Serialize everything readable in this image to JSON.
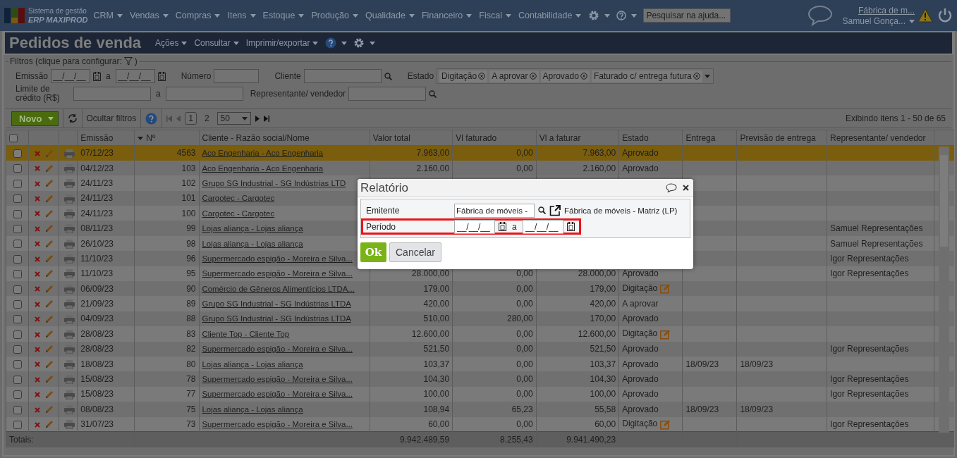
{
  "app": {
    "brand_top": "Sistema de gestão",
    "brand_name": "ERP MAXIPROD"
  },
  "menu": [
    {
      "label": "CRM"
    },
    {
      "label": "Vendas"
    },
    {
      "label": "Compras"
    },
    {
      "label": "Itens"
    },
    {
      "label": "Estoque"
    },
    {
      "label": "Produção"
    },
    {
      "label": "Qualidade"
    },
    {
      "label": "Financeiro"
    },
    {
      "label": "Fiscal"
    },
    {
      "label": "Contabilidade"
    }
  ],
  "help_search": {
    "placeholder": "Pesquisar na ajuda..."
  },
  "user": {
    "company": "Fábrica de m...",
    "name": "Samuel Gonça..."
  },
  "page": {
    "title": "Pedidos de venda",
    "actions": [
      "Ações",
      "Consultar",
      "Imprimir/exportar"
    ]
  },
  "filters": {
    "legend": "Filtros (clique para configurar:",
    "legend_end": ")",
    "emissao": {
      "label": "Emissão",
      "from": {
        "placeholder": "__/__/__"
      },
      "sep": "a",
      "to": {
        "placeholder": "__/__/__"
      }
    },
    "numero": {
      "label": "Número"
    },
    "cliente": {
      "label": "Cliente"
    },
    "estado": {
      "label": "Estado",
      "tags": [
        "Digitação",
        "A aprovar",
        "Aprovado",
        "Faturado c/ entrega futura"
      ]
    },
    "limite": {
      "label": "Limite de crédito (R$)",
      "sep": "a"
    },
    "representante": {
      "label": "Representante/ vendedor"
    }
  },
  "toolbar": {
    "new_button": "Novo",
    "hide_filters": "Ocultar filtros",
    "pages": [
      {
        "label": "1",
        "selected": true
      },
      {
        "label": "2",
        "selected": false
      }
    ],
    "page_size": "50",
    "status": "Exibindo itens 1 - 50 de 65"
  },
  "table": {
    "all_checked": false,
    "columns": [
      {
        "label": "Emissão",
        "sorted": false
      },
      {
        "label": "Nº",
        "sorted": true
      },
      {
        "label": "Cliente - Razão social/Nome",
        "sorted": false
      },
      {
        "label": "Valor total",
        "sorted": false
      },
      {
        "label": "Vl faturado",
        "sorted": false
      },
      {
        "label": "Vl a faturar",
        "sorted": false
      },
      {
        "label": "Estado",
        "sorted": false
      },
      {
        "label": "Entrega",
        "sorted": false
      },
      {
        "label": "Previsão de entrega",
        "sorted": false
      },
      {
        "label": "Representante/ vendedor",
        "sorted": false
      }
    ],
    "rows": [
      {
        "selected": true,
        "checked": false,
        "draft": false,
        "cells": [
          "07/12/23",
          "4563",
          "Aco Engenharia - Aco Engenharia",
          "7.963,00",
          "0,00",
          "7.963,00",
          "Aprovado",
          null,
          null,
          null
        ]
      },
      {
        "selected": false,
        "checked": false,
        "draft": false,
        "cells": [
          "04/12/23",
          "103",
          "Aco Engenharia - Aco Engenharia",
          "2.160,00",
          "0,00",
          "2.160,00",
          "Aprovado",
          null,
          null,
          null
        ]
      },
      {
        "selected": false,
        "checked": false,
        "cells": [
          "24/11/23",
          "102",
          "Grupo SG Industrial - SG Indústrias LTD",
          null,
          null,
          null,
          null,
          null,
          null,
          null
        ]
      },
      {
        "selected": false,
        "checked": false,
        "cells": [
          "24/11/23",
          "101",
          "Cargotec - Cargotec",
          null,
          null,
          null,
          null,
          null,
          null,
          null
        ]
      },
      {
        "selected": false,
        "checked": false,
        "cells": [
          "24/11/23",
          "100",
          "Cargotec - Cargotec",
          null,
          null,
          null,
          null,
          null,
          null,
          null
        ]
      },
      {
        "selected": false,
        "checked": false,
        "cells": [
          "08/11/23",
          "99",
          "Lojas aliança - Lojas aliança",
          null,
          null,
          null,
          null,
          null,
          null,
          "Samuel Representações"
        ]
      },
      {
        "selected": false,
        "checked": false,
        "cells": [
          "26/10/23",
          "98",
          "Lojas aliança - Lojas aliança",
          null,
          null,
          null,
          null,
          null,
          null,
          "Samuel Representações"
        ]
      },
      {
        "selected": false,
        "checked": false,
        "cells": [
          "11/10/23",
          "96",
          "Supermercado espigão - Moreira e Silva...",
          null,
          null,
          null,
          null,
          null,
          null,
          "Igor Representações"
        ]
      },
      {
        "selected": false,
        "checked": false,
        "draft": false,
        "cells": [
          "11/10/23",
          "95",
          "Supermercado espigão - Moreira e Silva...",
          "28.000,00",
          "0,00",
          "28.000,00",
          "Aprovado",
          null,
          null,
          "Igor Representações"
        ]
      },
      {
        "selected": false,
        "checked": false,
        "draft": true,
        "cells": [
          "06/09/23",
          "90",
          "Comércio de Gêneros Alimentícios LTDA...",
          "179,00",
          "0,00",
          "179,00",
          "Digitação",
          null,
          null,
          null
        ]
      },
      {
        "selected": false,
        "checked": false,
        "draft": false,
        "cells": [
          "21/09/23",
          "89",
          "Grupo SG Industrial - SG Indústrias LTDA",
          "420,00",
          "0,00",
          "420,00",
          "A aprovar",
          null,
          null,
          null
        ]
      },
      {
        "selected": false,
        "checked": false,
        "draft": false,
        "cells": [
          "04/09/23",
          "88",
          "Grupo SG Industrial - SG Indústrias LTDA",
          "510,00",
          "280,00",
          "170,00",
          "Aprovado",
          null,
          null,
          null
        ]
      },
      {
        "selected": false,
        "checked": false,
        "draft": true,
        "cells": [
          "28/08/23",
          "83",
          "Cliente Top - Cliente Top",
          "12.600,00",
          "0,00",
          "12.600,00",
          "Digitação",
          null,
          null,
          null
        ]
      },
      {
        "selected": false,
        "checked": false,
        "draft": false,
        "cells": [
          "28/08/23",
          "82",
          "Supermercado espigão - Moreira e Silva...",
          "521,50",
          "0,00",
          "521,50",
          "Aprovado",
          null,
          null,
          "Igor Representações"
        ]
      },
      {
        "selected": false,
        "checked": false,
        "draft": false,
        "cells": [
          "18/08/23",
          "80",
          "Lojas aliança - Lojas aliança",
          "103,37",
          "0,00",
          "103,37",
          "Aprovado",
          "18/09/23",
          "18/09/23",
          null
        ]
      },
      {
        "selected": false,
        "checked": false,
        "draft": false,
        "cells": [
          "15/08/23",
          "78",
          "Supermercado espigão - Moreira e Silva...",
          "104,30",
          "0,00",
          "104,30",
          "Aprovado",
          null,
          null,
          "Igor Representações"
        ]
      },
      {
        "selected": false,
        "checked": false,
        "draft": false,
        "cells": [
          "15/08/23",
          "77",
          "Supermercado espigão - Moreira e Silva...",
          "100,00",
          "0,00",
          "100,00",
          "Aprovado",
          null,
          null,
          "Igor Representações"
        ]
      },
      {
        "selected": false,
        "checked": false,
        "draft": false,
        "cells": [
          "08/08/23",
          "75",
          "Lojas aliança - Lojas aliança",
          "108,94",
          "65,23",
          "55,58",
          "Aprovado",
          "18/09/23",
          "18/09/23",
          null
        ]
      },
      {
        "selected": false,
        "checked": false,
        "draft": true,
        "cells": [
          "31/07/23",
          "73",
          "Supermercado espigão - Moreira e Silva...",
          "60,00",
          "0,00",
          "60,00",
          "Digitação",
          null,
          null,
          "Igor Representações"
        ]
      }
    ],
    "totals": {
      "label": "Totais:",
      "values": [
        "9.942.489,59",
        "8.255,43",
        "9.941.490,23"
      ]
    }
  },
  "dialog": {
    "title": "Relatório",
    "fields": [
      {
        "label": "Emitente",
        "kind": "lookup",
        "value": "Fábrica de móveis -",
        "detail": "Fábrica de móveis - Matriz (LP)",
        "highlighted": false
      },
      {
        "label": "Período",
        "kind": "daterange",
        "from": {
          "placeholder": "__/__/__"
        },
        "sep": "a",
        "to": {
          "placeholder": "__/__/__"
        },
        "highlighted": true
      }
    ],
    "ok": "Ok",
    "cancel": "Cancelar"
  }
}
